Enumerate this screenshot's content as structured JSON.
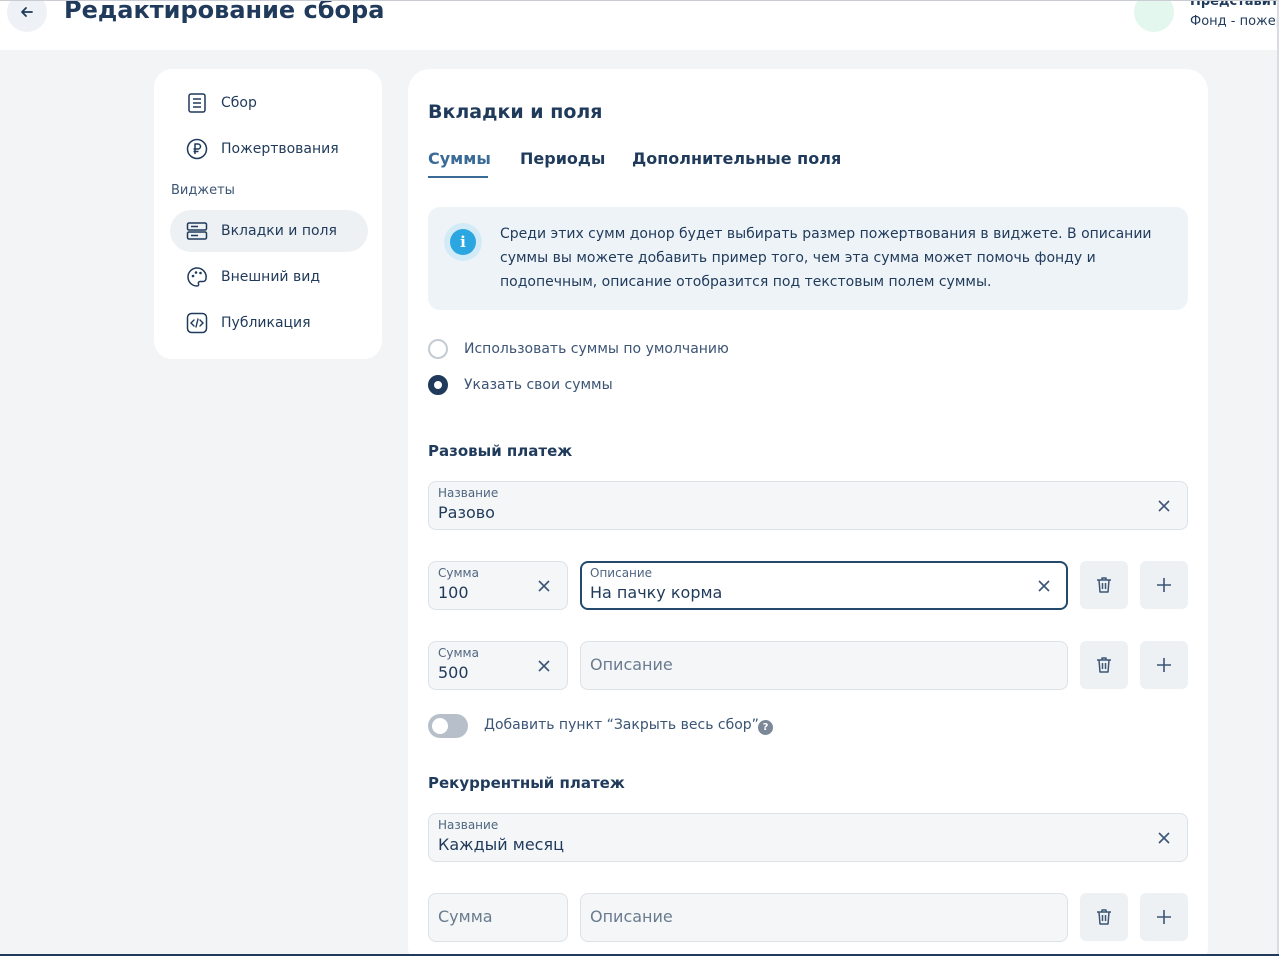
{
  "header": {
    "back_icon": "arrow-left-icon",
    "title": "Редактирование сбора",
    "user_name": "Представит",
    "user_org": "Фонд - пожерт"
  },
  "sidebar": {
    "items_top": [
      {
        "label": "Сбор",
        "icon": "receipt-icon"
      },
      {
        "label": "Пожертвования",
        "icon": "ruble-icon"
      }
    ],
    "section_label": "Виджеты",
    "items_widgets": [
      {
        "label": "Вкладки и поля",
        "icon": "layout-icon",
        "active": true
      },
      {
        "label": "Внешний вид",
        "icon": "palette-icon",
        "active": false
      },
      {
        "label": "Публикация",
        "icon": "code-icon",
        "active": false
      }
    ]
  },
  "main": {
    "title": "Вкладки и поля",
    "tabs": [
      {
        "label": "Суммы",
        "active": true
      },
      {
        "label": "Периоды",
        "active": false
      },
      {
        "label": "Дополнительные поля",
        "active": false
      }
    ],
    "info_text": "Среди этих сумм донор будет выбирать размер пожертвования в виджете. В описании суммы вы можете добавить пример того, чем эта сумма может помочь фонду и подопечным, описание отобразится под текстовым полем суммы.",
    "radios": [
      {
        "label": "Использовать суммы по умолчанию",
        "checked": false
      },
      {
        "label": "Указать свои суммы",
        "checked": true
      }
    ],
    "one_time": {
      "title": "Разовый платеж",
      "name_label": "Название",
      "name_value": "Разово",
      "rows": [
        {
          "sum_label": "Сумма",
          "sum_value": "100",
          "desc_label": "Описание",
          "desc_value": "На пачку корма"
        },
        {
          "sum_label": "Сумма",
          "sum_value": "500",
          "desc_placeholder": "Описание"
        }
      ]
    },
    "toggle": {
      "label": "Добавить пункт “Закрыть весь сбор”",
      "on": false,
      "help": "?"
    },
    "recurring": {
      "title": "Рекуррентный платеж",
      "name_label": "Название",
      "name_value": "Каждый месяц",
      "rows": [
        {
          "sum_placeholder": "Сумма",
          "desc_placeholder": "Описание"
        }
      ]
    }
  },
  "colors": {
    "primary": "#1f3a5a",
    "accent_tab": "#3a6a96",
    "info_bg": "#eef3f8",
    "info_icon": "#2ba6e0",
    "page_bg": "#f2f4f6"
  }
}
